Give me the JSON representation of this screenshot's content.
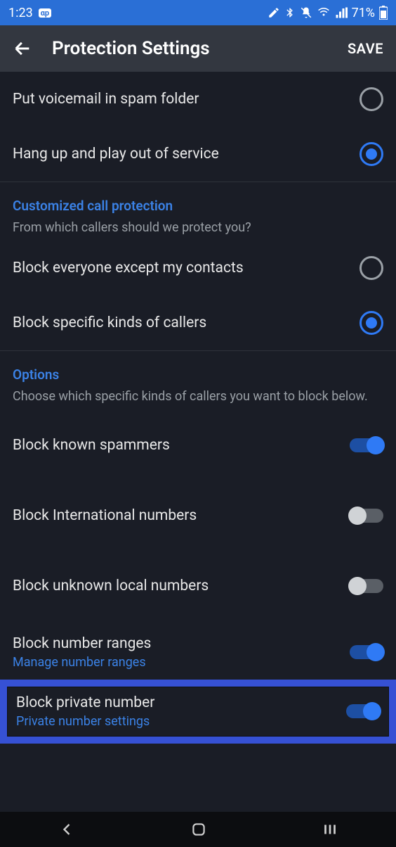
{
  "status": {
    "time": "1:23",
    "badge": "αр",
    "battery_pct": "71%"
  },
  "appbar": {
    "title": "Protection Settings",
    "save": "SAVE"
  },
  "section_handling": {
    "radios": [
      {
        "label": "Put voicemail in spam folder",
        "selected": false
      },
      {
        "label": "Hang up and play out of service",
        "selected": true
      }
    ]
  },
  "section_custom": {
    "title": "Customized call protection",
    "desc": "From which callers should we protect you?",
    "radios": [
      {
        "label": "Block everyone except my contacts",
        "selected": false
      },
      {
        "label": "Block specific kinds of callers",
        "selected": true
      }
    ]
  },
  "section_options": {
    "title": "Options",
    "desc": "Choose which specific kinds of callers you want to block below.",
    "toggles": [
      {
        "label": "Block known spammers",
        "on": true
      },
      {
        "label": "Block International numbers",
        "on": false
      },
      {
        "label": "Block unknown local numbers",
        "on": false
      },
      {
        "label": "Block number ranges",
        "sub": "Manage number ranges",
        "on": true
      },
      {
        "label": "Block private number",
        "sub": "Private number settings",
        "on": true,
        "highlighted": true
      }
    ]
  }
}
